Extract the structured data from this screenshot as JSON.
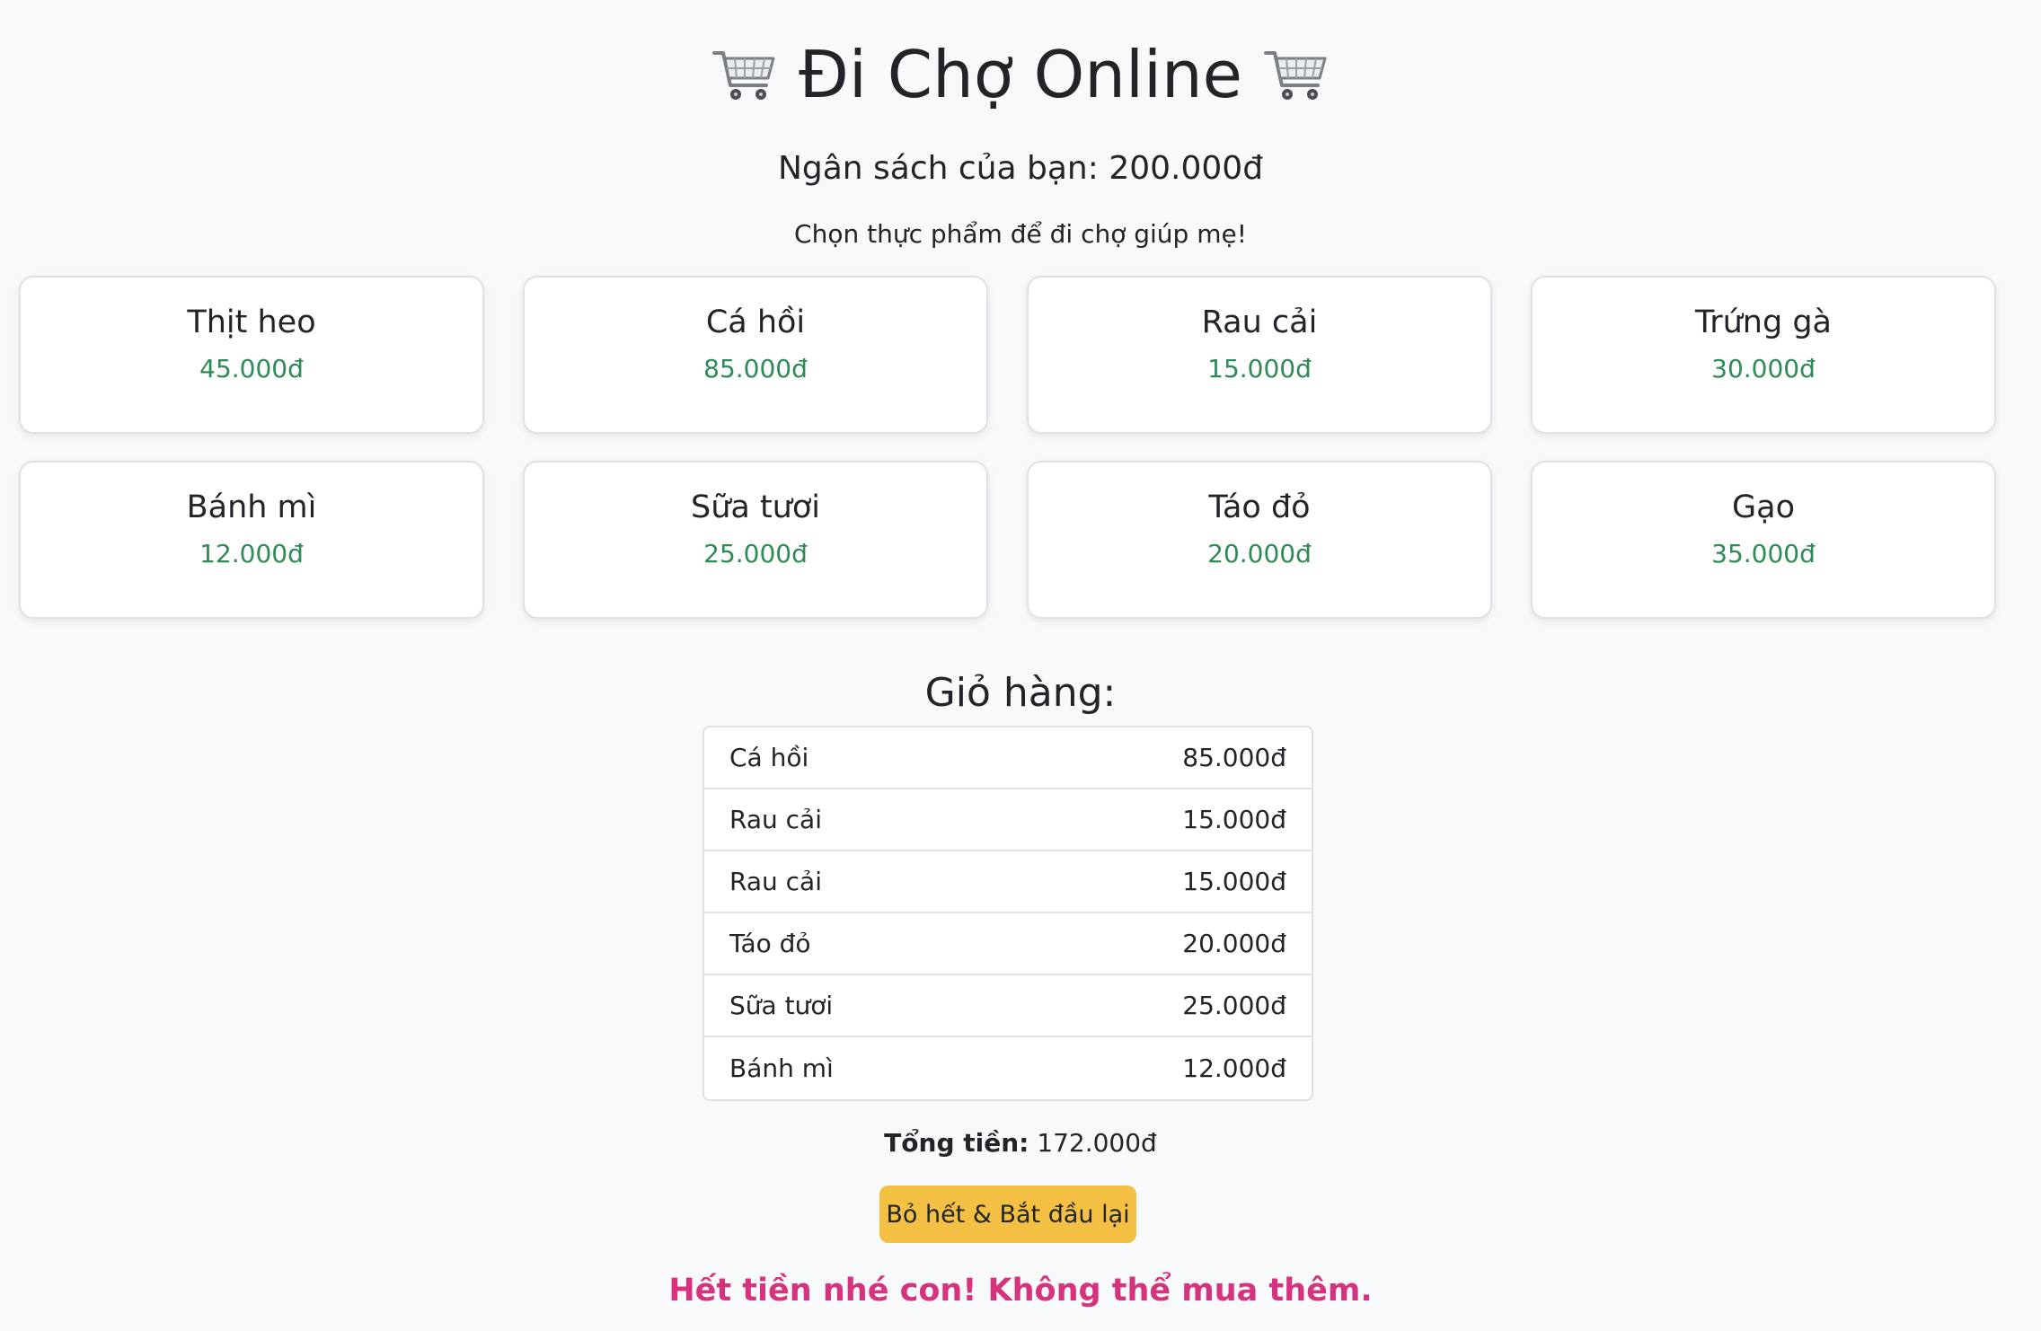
{
  "header": {
    "title": "Đi Chợ Online",
    "icon_left": "shopping-cart-icon",
    "icon_right": "shopping-cart-icon"
  },
  "budget_text": "Ngân sách của bạn: 200.000đ",
  "instruction": "Chọn thực phẩm để đi chợ giúp mẹ!",
  "products": [
    {
      "name": "Thịt heo",
      "price": "45.000đ"
    },
    {
      "name": "Cá hồi",
      "price": "85.000đ"
    },
    {
      "name": "Rau cải",
      "price": "15.000đ"
    },
    {
      "name": "Trứng gà",
      "price": "30.000đ"
    },
    {
      "name": "Bánh mì",
      "price": "12.000đ"
    },
    {
      "name": "Sữa tươi",
      "price": "25.000đ"
    },
    {
      "name": "Táo đỏ",
      "price": "20.000đ"
    },
    {
      "name": "Gạo",
      "price": "35.000đ"
    }
  ],
  "cart": {
    "title": "Giỏ hàng:",
    "items": [
      {
        "name": "Cá hồi",
        "price": "85.000đ"
      },
      {
        "name": "Rau cải",
        "price": "15.000đ"
      },
      {
        "name": "Rau cải",
        "price": "15.000đ"
      },
      {
        "name": "Táo đỏ",
        "price": "20.000đ"
      },
      {
        "name": "Sữa tươi",
        "price": "25.000đ"
      },
      {
        "name": "Bánh mì",
        "price": "12.000đ"
      }
    ],
    "total_label": "Tổng tiền:",
    "total_value": "172.000đ"
  },
  "reset_button_label": "Bỏ hết & Bắt đầu lại",
  "message": "Hết tiền nhé con! Không thể mua thêm.",
  "colors": {
    "background": "#f8f9fa",
    "price_green": "#2e8b57",
    "button_yellow": "#f3c044",
    "message_pink": "#d6337e"
  }
}
